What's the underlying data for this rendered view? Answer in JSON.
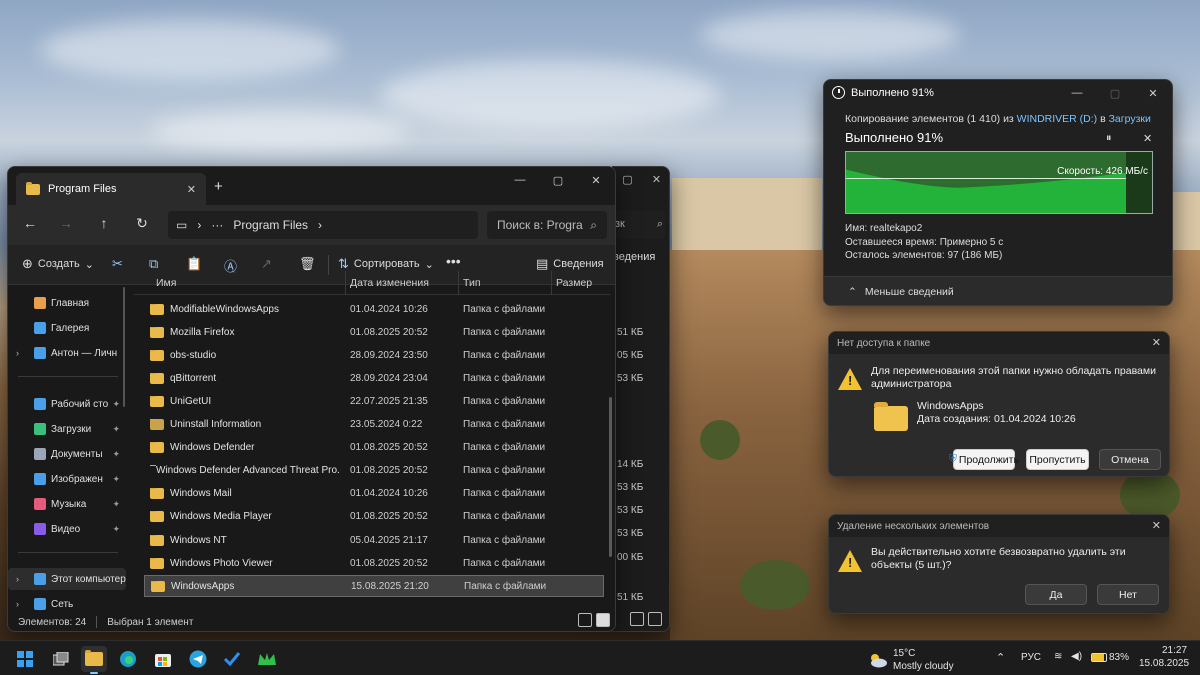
{
  "explorer": {
    "tab_title": "Program Files",
    "path": "Program Files",
    "search_placeholder": "Поиск в: Progra",
    "back_search_fragment": "зк",
    "commands": {
      "create": "Создать",
      "sort": "Сортировать",
      "details": "Сведения",
      "details_behind": "ведения"
    },
    "columns": {
      "name": "Имя",
      "date": "Дата изменения",
      "type": "Тип",
      "size": "Размер"
    },
    "sidebar": [
      {
        "label": "Главная",
        "icon": "home-icon"
      },
      {
        "label": "Галерея",
        "icon": "gallery-icon"
      },
      {
        "label": "Антон — Личн",
        "icon": "onedrive-icon"
      },
      {
        "label": "Рабочий сто",
        "icon": "desktop-icon"
      },
      {
        "label": "Загрузки",
        "icon": "downloads-icon"
      },
      {
        "label": "Документы",
        "icon": "documents-icon"
      },
      {
        "label": "Изображен",
        "icon": "pictures-icon"
      },
      {
        "label": "Музыка",
        "icon": "music-icon"
      },
      {
        "label": "Видео",
        "icon": "video-icon"
      },
      {
        "label": "Этот компьютер",
        "icon": "this-pc-icon"
      },
      {
        "label": "Сеть",
        "icon": "network-icon"
      }
    ],
    "files": [
      {
        "name": "ModifiableWindowsApps",
        "date": "01.04.2024 10:26",
        "type": "Папка с файлами"
      },
      {
        "name": "Mozilla Firefox",
        "date": "01.08.2025 20:52",
        "type": "Папка с файлами"
      },
      {
        "name": "obs-studio",
        "date": "28.09.2024 23:50",
        "type": "Папка с файлами"
      },
      {
        "name": "qBittorrent",
        "date": "28.09.2024 23:04",
        "type": "Папка с файлами"
      },
      {
        "name": "UniGetUI",
        "date": "22.07.2025 21:35",
        "type": "Папка с файлами"
      },
      {
        "name": "Uninstall Information",
        "date": "23.05.2024 0:22",
        "type": "Папка с файлами"
      },
      {
        "name": "Windows Defender",
        "date": "01.08.2025 20:52",
        "type": "Папка с файлами"
      },
      {
        "name": "Windows Defender Advanced Threat Pro...",
        "date": "01.08.2025 20:52",
        "type": "Папка с файлами"
      },
      {
        "name": "Windows Mail",
        "date": "01.04.2024 10:26",
        "type": "Папка с файлами"
      },
      {
        "name": "Windows Media Player",
        "date": "01.08.2025 20:52",
        "type": "Папка с файлами"
      },
      {
        "name": "Windows NT",
        "date": "05.04.2025 21:17",
        "type": "Папка с файлами"
      },
      {
        "name": "Windows Photo Viewer",
        "date": "01.08.2025 20:52",
        "type": "Папка с файлами"
      },
      {
        "name": "WindowsApps",
        "date": "15.08.2025 21:20",
        "type": "Папка с файлами"
      }
    ],
    "back_sizes": [
      "51 КБ",
      "05 КБ",
      "53 КБ",
      "14 КБ",
      "53 КБ",
      "53 КБ",
      "53 КБ",
      "00 КБ",
      "51 КБ"
    ],
    "status": {
      "items": "Элементов: 24",
      "selected": "Выбран 1 элемент"
    }
  },
  "copy_dialog": {
    "title": "Выполнено 91%",
    "copying_prefix": "Копирование элементов (1 410) из",
    "source": "WINDRIVER (D:)",
    "to_word": "в",
    "destination": "Загрузки",
    "progress_label": "Выполнено 91%",
    "progress_fraction": 0.91,
    "speed": "Скорость: 426 МБ/с",
    "name_line": "Имя: realtekapo2",
    "time_left": "Оставшееся время: Примерно 5 с",
    "items_left": "Осталось элементов: 97 (186 МБ)",
    "less_details": "Меньше сведений"
  },
  "access_dialog": {
    "title": "Нет доступа к папке",
    "message": "Для переименования этой папки нужно обладать правами администратора",
    "folder_name": "WindowsApps",
    "created": "Дата создания: 01.04.2024 10:26",
    "continue": "Продолжить",
    "skip": "Пропустить",
    "cancel": "Отмена"
  },
  "delete_dialog": {
    "title": "Удаление нескольких элементов",
    "message": "Вы действительно хотите безвозвратно удалить эти объекты (5 шт.)?",
    "yes": "Да",
    "no": "Нет"
  },
  "taskbar": {
    "weather_temp": "15°C",
    "weather_desc": "Mostly cloudy",
    "lang": "РУС",
    "battery": "83%",
    "time": "21:27",
    "date": "15.08.2025"
  }
}
